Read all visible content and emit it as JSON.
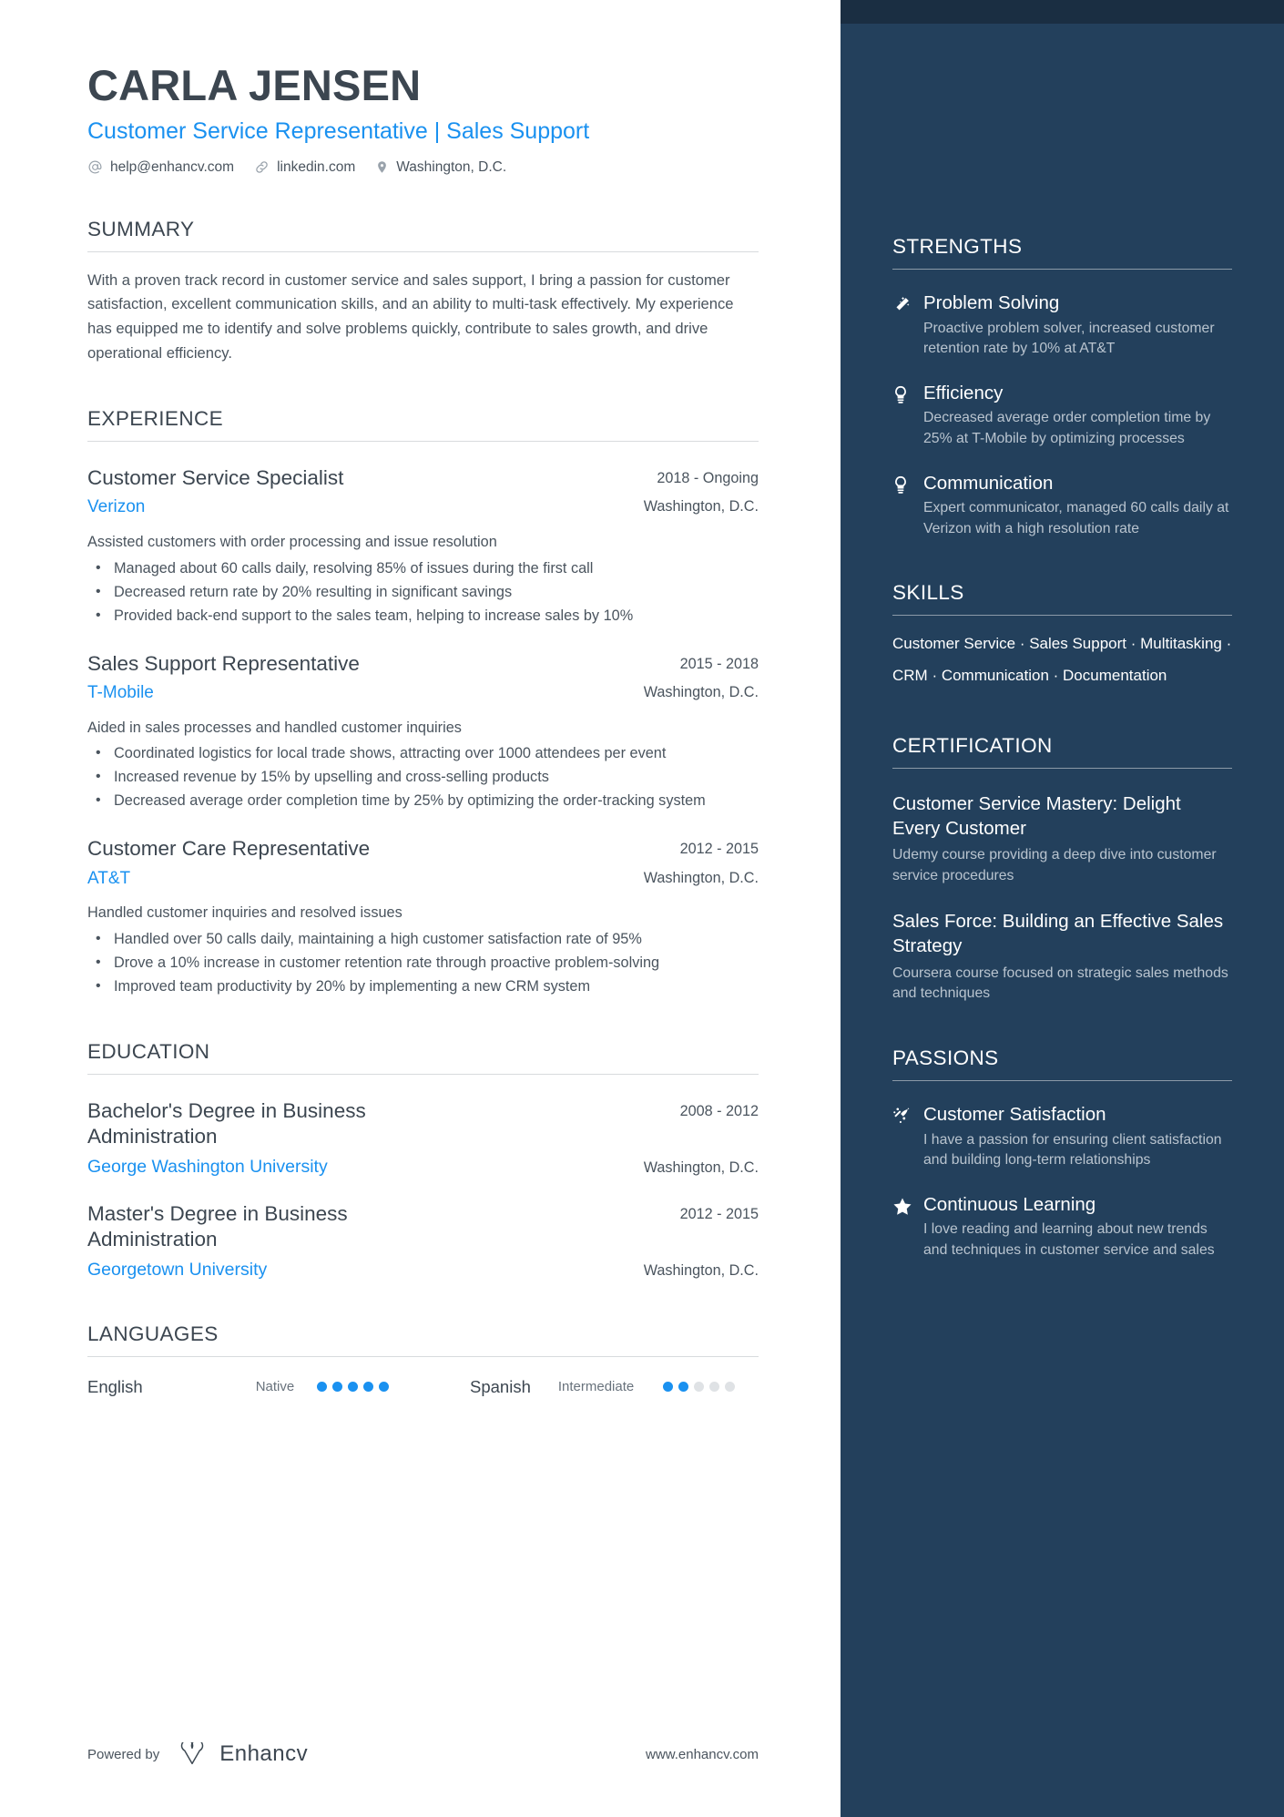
{
  "header": {
    "name": "CARLA JENSEN",
    "headline": "Customer Service Representative | Sales Support",
    "contacts": [
      {
        "icon": "at-icon",
        "text": "help@enhancv.com"
      },
      {
        "icon": "link-icon",
        "text": "linkedin.com"
      },
      {
        "icon": "location-pin-icon",
        "text": "Washington, D.C."
      }
    ]
  },
  "summary": {
    "title": "SUMMARY",
    "text": "With a proven track record in customer service and sales support, I bring a passion for customer satisfaction, excellent communication skills, and an ability to multi-task effectively. My experience has equipped me to identify and solve problems quickly, contribute to sales growth, and drive operational efficiency."
  },
  "experience": {
    "title": "EXPERIENCE",
    "entries": [
      {
        "role": "Customer Service Specialist",
        "company": "Verizon",
        "dates": "2018 - Ongoing",
        "location": "Washington, D.C.",
        "summary": "Assisted customers with order processing and issue resolution",
        "bullets": [
          "Managed about 60 calls daily, resolving 85% of issues during the first call",
          "Decreased return rate by 20% resulting in significant savings",
          "Provided back-end support to the sales team, helping to increase sales by 10%"
        ]
      },
      {
        "role": "Sales Support Representative",
        "company": "T-Mobile",
        "dates": "2015 - 2018",
        "location": "Washington, D.C.",
        "summary": "Aided in sales processes and handled customer inquiries",
        "bullets": [
          "Coordinated logistics for local trade shows, attracting over 1000 attendees per event",
          "Increased revenue by 15% by upselling and cross-selling products",
          "Decreased average order completion time by 25% by optimizing the order-tracking system"
        ]
      },
      {
        "role": "Customer Care Representative",
        "company": "AT&T",
        "dates": "2012 - 2015",
        "location": "Washington, D.C.",
        "summary": "Handled customer inquiries and resolved issues",
        "bullets": [
          "Handled over 50 calls daily, maintaining a high customer satisfaction rate of 95%",
          "Drove a 10% increase in customer retention rate through proactive problem-solving",
          "Improved team productivity by 20% by implementing a new CRM system"
        ]
      }
    ]
  },
  "education": {
    "title": "EDUCATION",
    "entries": [
      {
        "degree": "Bachelor's Degree in Business Administration",
        "school": "George Washington University",
        "dates": "2008 - 2012",
        "location": "Washington, D.C."
      },
      {
        "degree": "Master's Degree in Business Administration",
        "school": "Georgetown University",
        "dates": "2012 - 2015",
        "location": "Washington, D.C."
      }
    ]
  },
  "languages": {
    "title": "LANGUAGES",
    "items": [
      {
        "name": "English",
        "level": "Native",
        "filled": 5,
        "total": 5
      },
      {
        "name": "Spanish",
        "level": "Intermediate",
        "filled": 2,
        "total": 5
      }
    ]
  },
  "footer": {
    "powered_by": "Powered by",
    "brand": "Enhancv",
    "website": "www.enhancv.com"
  },
  "strengths": {
    "title": "STRENGTHS",
    "items": [
      {
        "icon": "magic-wand-icon",
        "title": "Problem Solving",
        "desc": "Proactive problem solver, increased customer retention rate by 10% at AT&T"
      },
      {
        "icon": "lightbulb-icon",
        "title": "Efficiency",
        "desc": "Decreased average order completion time by 25% at T-Mobile by optimizing processes"
      },
      {
        "icon": "lightbulb-icon",
        "title": "Communication",
        "desc": "Expert communicator, managed 60 calls daily at Verizon with a high resolution rate"
      }
    ]
  },
  "skills": {
    "title": "SKILLS",
    "text": "Customer Service · Sales Support · Multitasking · CRM · Communication · Documentation"
  },
  "certification": {
    "title": "CERTIFICATION",
    "items": [
      {
        "name": "Customer Service Mastery: Delight Every Customer",
        "desc": "Udemy course providing a deep dive into customer service procedures"
      },
      {
        "name": "Sales Force: Building an Effective Sales Strategy",
        "desc": "Coursera course focused on strategic sales methods and techniques"
      }
    ]
  },
  "passions": {
    "title": "PASSIONS",
    "items": [
      {
        "icon": "rocket-trail-icon",
        "title": "Customer Satisfaction",
        "desc": "I have a passion for ensuring client satisfaction and building long-term relationships"
      },
      {
        "icon": "star-icon",
        "title": "Continuous Learning",
        "desc": "I love reading and learning about new trends and techniques in customer service and sales"
      }
    ]
  },
  "colors": {
    "accent_blue": "#1a91f0",
    "sidebar_bg": "#23405c",
    "sidebar_top_strip": "#1a2e42",
    "text_dark": "#3c4650",
    "text_body": "#4a545e"
  }
}
